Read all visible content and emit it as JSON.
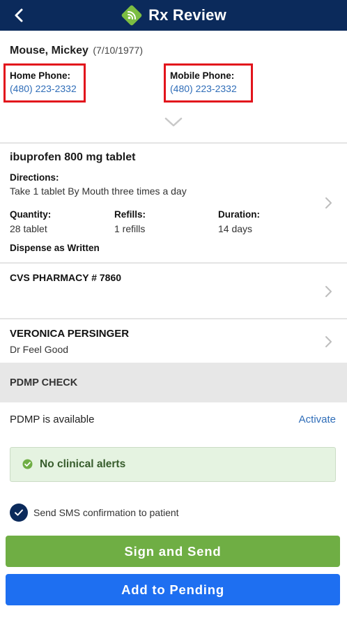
{
  "header": {
    "title": "Rx Review",
    "bg_color": "#0b2a5b",
    "back_icon": "chevron-left-icon",
    "logo_icon": "rx-signal-logo-icon"
  },
  "patient": {
    "name": "Mouse, Mickey",
    "dob": "(7/10/1977)",
    "home_phone_label": "Home Phone:",
    "home_phone": "(480) 223-2332",
    "mobile_phone_label": "Mobile Phone:",
    "mobile_phone": "(480) 223-2332",
    "expand_icon": "chevron-down-icon",
    "highlight_color": "#e2141c"
  },
  "prescription": {
    "drug": "ibuprofen 800 mg tablet",
    "directions_label": "Directions:",
    "directions": "Take 1 tablet By Mouth three times a day",
    "quantity_label": "Quantity:",
    "quantity": "28 tablet",
    "refills_label": "Refills:",
    "refills": "1 refills",
    "duration_label": "Duration:",
    "duration": "14 days",
    "daw_label": "Dispense as Written"
  },
  "pharmacy": {
    "name": "CVS PHARMACY # 7860"
  },
  "prescriber": {
    "name": "VERONICA PERSINGER",
    "subtitle": "Dr Feel Good"
  },
  "pdmp": {
    "header": "PDMP CHECK",
    "status": "PDMP is available",
    "action": "Activate"
  },
  "alerts": {
    "text": "No clinical alerts",
    "icon": "check-circle-icon",
    "color": "#375c2c"
  },
  "sms": {
    "label": "Send SMS confirmation to patient",
    "checked": true
  },
  "buttons": {
    "sign_send": "Sign and Send",
    "sign_send_color": "#6fae44",
    "add_pending": "Add to Pending",
    "add_pending_color": "#1e6ff1"
  }
}
